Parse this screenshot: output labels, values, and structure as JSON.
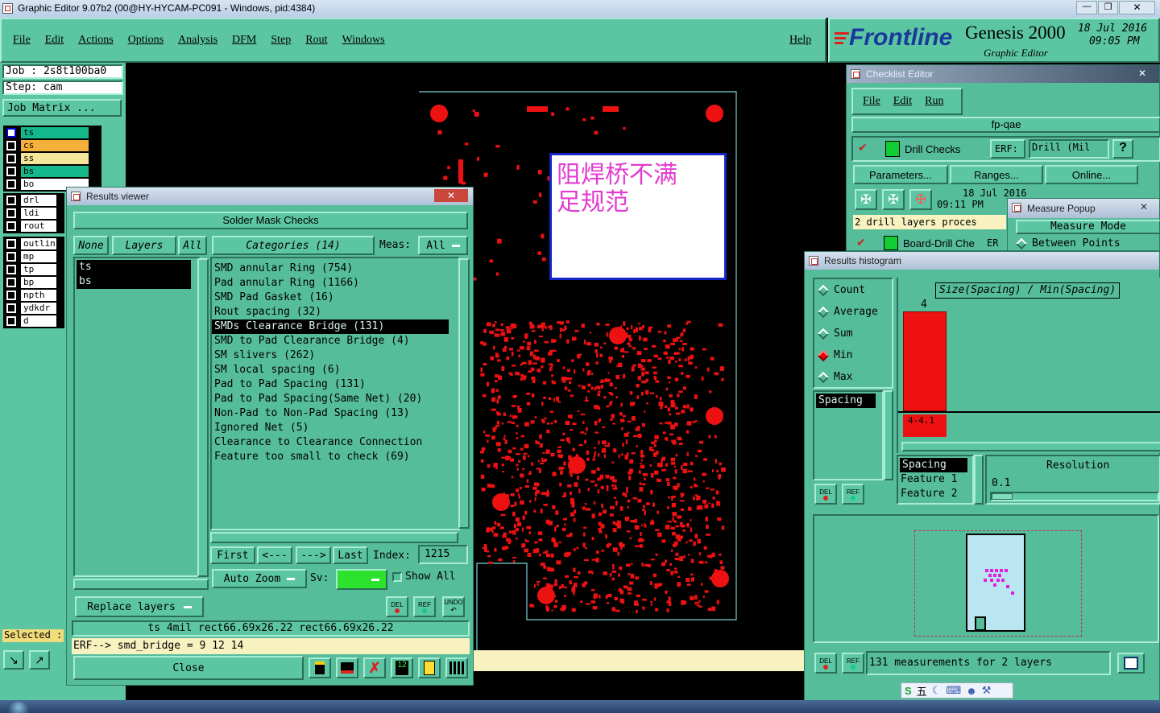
{
  "window": {
    "title": "Graphic Editor 9.07b2 (00@HY-HYCAM-PC091 - Windows, pid:4384)"
  },
  "menu": [
    "File",
    "Edit",
    "Actions",
    "Options",
    "Analysis",
    "DFM",
    "Step",
    "Rout",
    "Windows"
  ],
  "help": "Help",
  "brand": {
    "logo": "Frontline",
    "product": "Genesis 2000",
    "subtitle": "Graphic Editor",
    "date": "18 Jul 2016",
    "time": "09:05 PM"
  },
  "job": {
    "job_label": "Job : 2s8t100ba0",
    "step_label": "Step: cam",
    "matrix": "Job Matrix ..."
  },
  "layers_group1": [
    "ts",
    "cs",
    "ss",
    "bs",
    "bo"
  ],
  "layers_group2": [
    "drl",
    "ldi",
    "rout"
  ],
  "layers_group3": [
    "outlin",
    "mp",
    "tp",
    "bp",
    "npth",
    "ydkdr",
    "d"
  ],
  "selected_label": "Selected :",
  "annotation": {
    "text": "阻焊桥不满足规范"
  },
  "results_viewer": {
    "title": "Results viewer",
    "header": "Solder Mask Checks",
    "none_btn": "None",
    "layers_btn": "Layers",
    "all_btn": "All",
    "categories_btn": "Categories (14)",
    "meas_label": "Meas:",
    "meas_value": "All",
    "layers": [
      "ts",
      "bs"
    ],
    "categories": [
      "SMD annular Ring (754)",
      "Pad annular Ring (1166)",
      "SMD Pad Gasket (16)",
      "Rout spacing (32)",
      "SMDs Clearance Bridge (131)",
      "SMD to Pad Clearance Bridge (4)",
      "SM slivers (262)",
      "SM local spacing (6)",
      "Pad to Pad Spacing (131)",
      "Pad to Pad Spacing(Same Net) (20)",
      "Non-Pad to Non-Pad Spacing (13)",
      "Ignored Net (5)",
      "Clearance to Clearance Connection",
      "Feature too small to check (69)"
    ],
    "selected_index": 4,
    "first": "First",
    "prev": "<---",
    "next": "--->",
    "last": "Last",
    "index_label": "Index:",
    "index_value": "1215",
    "auto_zoom": "Auto Zoom",
    "sv_label": "Sv:",
    "show_all": "Show All",
    "del": "DEL",
    "ref": "REF",
    "undo": "UNDO",
    "replace_layers": "Replace layers",
    "status": "ts 4mil   rect66.69x26.22   rect66.69x26.22",
    "erf_line": "ERF--> smd_bridge = 9 12 14",
    "close": "Close"
  },
  "checklist": {
    "title": "Checklist Editor",
    "menu": [
      "File",
      "Edit",
      "Run"
    ],
    "name": "fp-qae",
    "drill_checks": "Drill Checks",
    "erf_label": "ERF:",
    "erf_value": "Drill (Mil",
    "help_btn": "?",
    "parameters": "Parameters...",
    "ranges": "Ranges...",
    "online": "Online...",
    "date": "18 Jul 2016",
    "time": "09:11 PM",
    "message": "2 drill layers proces",
    "board_drill": "Board-Drill Che",
    "erf_short": "ER"
  },
  "measure_popup": {
    "title": "Measure Popup",
    "mode_label": "Measure Mode",
    "mode_value": "Between Points"
  },
  "histogram": {
    "title": "Results histogram",
    "options": [
      "Count",
      "Average",
      "Sum",
      "Min",
      "Max"
    ],
    "selected_option": "Min",
    "list_item": "Spacing",
    "chart_title": "Size(Spacing) / Min(Spacing)",
    "bar_value": "4",
    "bar_range": "4-4.1",
    "detail": [
      "Spacing",
      "Feature 1",
      "Feature 2"
    ],
    "resolution_label": "Resolution",
    "resolution_value": "0.1",
    "del": "DEL",
    "ref": "REF",
    "summary": "131 measurements for 2 layers"
  },
  "ime": "五"
}
